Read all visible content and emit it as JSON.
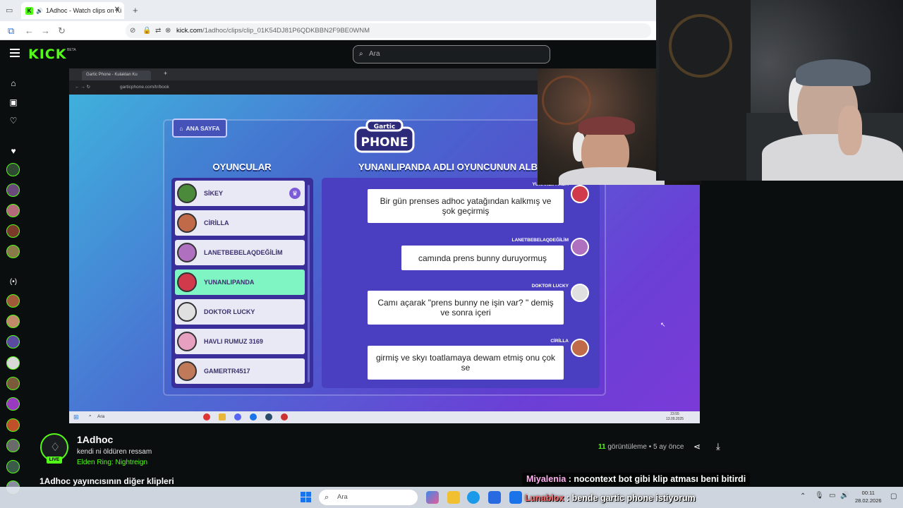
{
  "browser": {
    "tab_title": "1Adhoc - Watch clips on Ki",
    "url_host": "kick.com",
    "url_path": "/1adhoc/clips/clip_01K54DJ81P6QDKBBN2F9BE0WNM"
  },
  "kick": {
    "logo": "KICK",
    "beta": "BETA",
    "search_placeholder": "Ara"
  },
  "game": {
    "inner_tab": "Gartic Phone - Kulaktan Ku",
    "inner_url": "garticphone.com/tr/book",
    "home_label": "ANA SAYFA",
    "logo_top": "Gartic",
    "logo_bottom": "PHONE",
    "players_title": "OYUNCULAR",
    "album_title": "YUNANLIPANDA ADLI OYUNCUNUN ALB",
    "players": [
      {
        "name": "SİKEY"
      },
      {
        "name": "CİRİLLA"
      },
      {
        "name": "LANETBEBELAQDEĞİLİM"
      },
      {
        "name": "YUNANLIPANDA"
      },
      {
        "name": "DOKTOR LUCKY"
      },
      {
        "name": "HAVLI RUMUZ 3169"
      },
      {
        "name": "GAMERTR4517"
      }
    ],
    "entries": [
      {
        "author": "YUNANLIPANDA",
        "text": "Bir gün prenses adhoc yatağından kalkmış ve şok geçirmiş"
      },
      {
        "author": "LANETBEBELAQDEĞİLİM",
        "text": "camında prens bunny duruyormuş"
      },
      {
        "author": "DOKTOR LUCKY",
        "text": "Camı açarak \"prens bunny ne işin var? \" demiş ve sonra içeri"
      },
      {
        "author": "CİRİLLA",
        "text": "girmiş ve skyı toatlamaya dewam etmiş onu çok se"
      }
    ],
    "inner_taskbar_search": "Ara",
    "inner_time": "23:55",
    "inner_date": "13.09.2025"
  },
  "clip": {
    "streamer": "1Adhoc",
    "live_label": "LIVE",
    "title": "kendi ni öldüren ressam",
    "category": "Elden Ring: Nightreign",
    "views_count": "11",
    "views_label": "görüntüleme",
    "age": "5 ay önce",
    "more_clips": "1Adhoc yayıncısının diğer klipleri"
  },
  "chat": [
    {
      "user": "Miyalenia",
      "message": ": nocontext bot gibi klip atması beni bitirdi"
    },
    {
      "user": "Lunablox",
      "message": ": bende gartic phone istiyorum"
    }
  ],
  "taskbar": {
    "search_placeholder": "Ara",
    "time": "00:11",
    "date": "28.02.2026"
  },
  "colors": {
    "kick_green": "#53fc18",
    "active_player": "#7ff5c4"
  }
}
